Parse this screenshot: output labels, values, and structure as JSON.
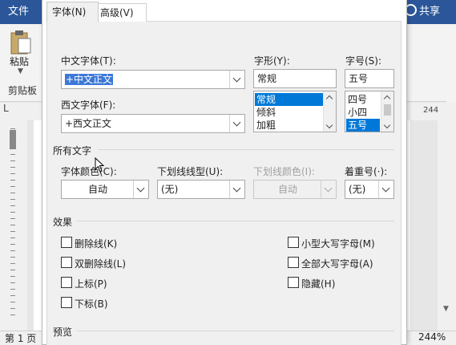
{
  "word": {
    "file_tab": "文件",
    "share": "共享",
    "paste_label": "粘贴",
    "clipboard_group": "剪贴板",
    "ruler_l": "L",
    "ruler_numbers": "244",
    "status_page": "第 1 页",
    "zoom": "244%"
  },
  "dialog": {
    "tabs": [
      "字体(N)",
      "高级(V)"
    ],
    "chinese_font": {
      "label": "中文字体(T):",
      "value": "+中文正文"
    },
    "western_font": {
      "label": "西文字体(F):",
      "value": "+西文正文"
    },
    "style": {
      "label": "字形(Y):",
      "value": "常规",
      "options": [
        "常规",
        "倾斜",
        "加粗"
      ],
      "selected": "常规"
    },
    "size": {
      "label": "字号(S):",
      "value": "五号",
      "options": [
        "四号",
        "小四",
        "五号"
      ],
      "selected": "五号"
    },
    "all_text": {
      "section": "所有文字",
      "font_color": {
        "label": "字体颜色(C):",
        "value": "自动"
      },
      "underline_type": {
        "label": "下划线线型(U):",
        "value": "(无)"
      },
      "underline_color": {
        "label": "下划线颜色(I):",
        "value": "自动"
      },
      "emphasis": {
        "label": "着重号(·):",
        "value": "(无)"
      }
    },
    "effects": {
      "section": "效果",
      "left": [
        "删除线(K)",
        "双删除线(L)",
        "上标(P)",
        "下标(B)"
      ],
      "right": [
        "小型大写字母(M)",
        "全部大写字母(A)",
        "隐藏(H)"
      ]
    },
    "preview": {
      "section": "预览"
    }
  },
  "colors": {
    "accent": "#2b579a",
    "selection": "#0078d7"
  }
}
